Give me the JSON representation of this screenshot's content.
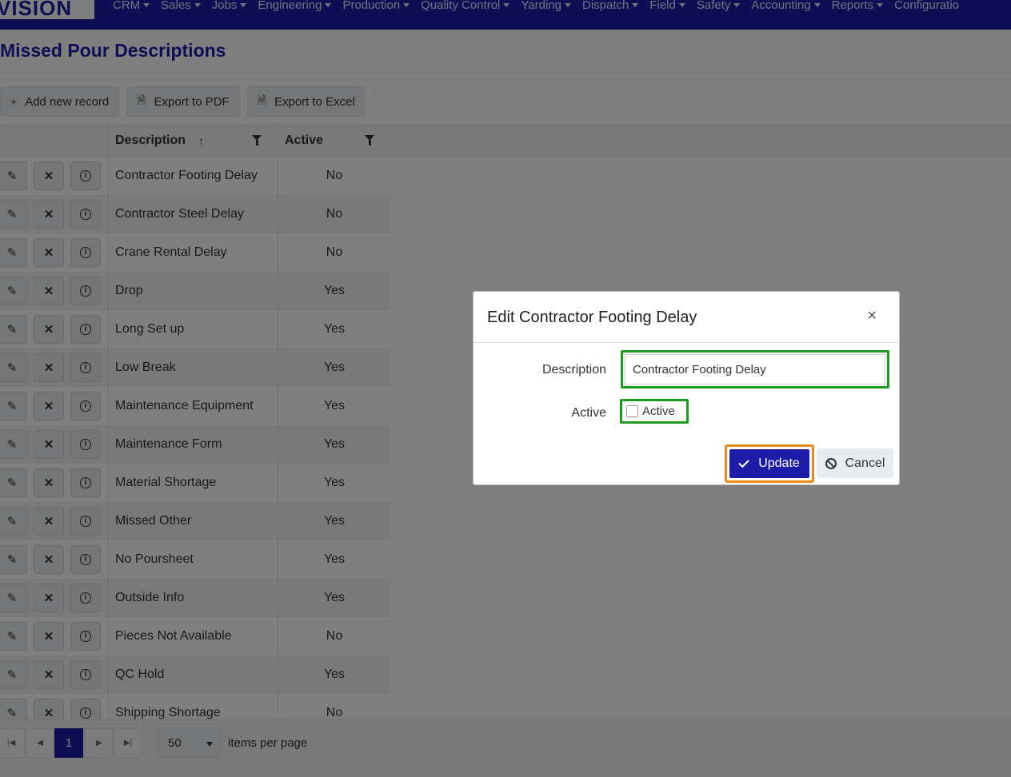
{
  "app": {
    "logo": "VISION"
  },
  "nav": {
    "items": [
      {
        "label": "CRM"
      },
      {
        "label": "Sales"
      },
      {
        "label": "Jobs"
      },
      {
        "label": "Engineering"
      },
      {
        "label": "Production"
      },
      {
        "label": "Quality Control"
      },
      {
        "label": "Yarding"
      },
      {
        "label": "Dispatch"
      },
      {
        "label": "Field"
      },
      {
        "label": "Safety"
      },
      {
        "label": "Accounting"
      },
      {
        "label": "Reports"
      },
      {
        "label": "Configuratio"
      }
    ]
  },
  "page": {
    "title": "Missed Pour Descriptions"
  },
  "toolbar": {
    "add_label": "Add new record",
    "pdf_label": "Export to PDF",
    "excel_label": "Export to Excel"
  },
  "grid": {
    "columns": {
      "description": "Description",
      "active": "Active"
    },
    "rows": [
      {
        "description": "Contractor Footing Delay",
        "active": "No"
      },
      {
        "description": "Contractor Steel Delay",
        "active": "No"
      },
      {
        "description": "Crane Rental Delay",
        "active": "No"
      },
      {
        "description": "Drop",
        "active": "Yes"
      },
      {
        "description": "Long Set up",
        "active": "Yes"
      },
      {
        "description": "Low Break",
        "active": "Yes"
      },
      {
        "description": "Maintenance Equipment",
        "active": "Yes"
      },
      {
        "description": "Maintenance Form",
        "active": "Yes"
      },
      {
        "description": "Material Shortage",
        "active": "Yes"
      },
      {
        "description": "Missed Other",
        "active": "Yes"
      },
      {
        "description": "No Poursheet",
        "active": "Yes"
      },
      {
        "description": "Outside Info",
        "active": "Yes"
      },
      {
        "description": "Pieces Not Available",
        "active": "No"
      },
      {
        "description": "QC Hold",
        "active": "Yes"
      },
      {
        "description": "Shipping Shortage",
        "active": "No"
      }
    ]
  },
  "pager": {
    "current_page": "1",
    "page_size": "50",
    "items_label": "items per page"
  },
  "modal": {
    "title": "Edit Contractor Footing Delay",
    "close": "×",
    "description_label": "Description",
    "description_value": "Contractor Footing Delay",
    "active_label": "Active",
    "active_checkbox_label": "Active",
    "update_label": "Update",
    "cancel_label": "Cancel"
  },
  "colors": {
    "brand": "#1c1ca8",
    "highlight_green": "#1b9e1b",
    "highlight_orange": "#e88a1a"
  }
}
